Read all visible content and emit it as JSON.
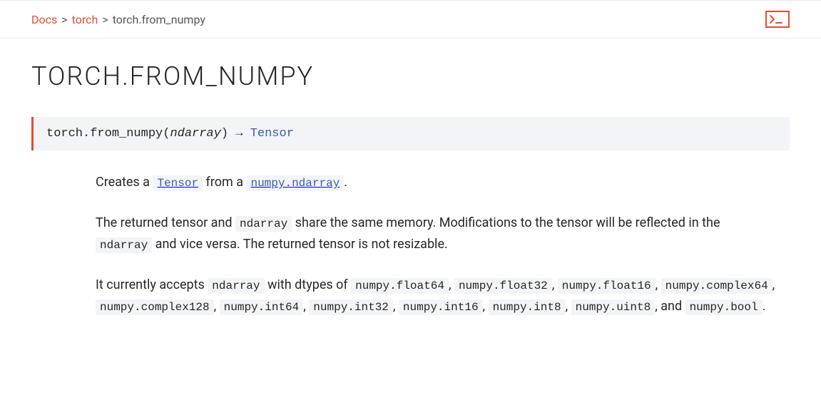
{
  "breadcrumb": {
    "items": [
      "Docs",
      "torch",
      "torch.from_numpy"
    ],
    "sep": ">"
  },
  "title": "TORCH.FROM_NUMPY",
  "signature": {
    "qualname_prefix": "torch.",
    "func_name": "from_numpy",
    "open_paren": "(",
    "param": "ndarray",
    "close_paren": ")",
    "arrow": " → ",
    "return_type": "Tensor"
  },
  "desc": {
    "p1": {
      "t1": "Creates a ",
      "c1": "Tensor",
      "t2": " from a ",
      "c2": "numpy.ndarray",
      "t3": "."
    },
    "p2": {
      "t1": "The returned tensor and ",
      "c1": "ndarray",
      "t2": " share the same memory. Modifications to the tensor will be reflected in the ",
      "c2": "ndarray",
      "t3": " and vice versa. The returned tensor is not resizable."
    },
    "p3": {
      "t1": "It currently accepts ",
      "c1": "ndarray",
      "t2": " with dtypes of ",
      "c2": "numpy.float64",
      "s1": ", ",
      "c3": "numpy.float32",
      "s2": ", ",
      "c4": "numpy.float16",
      "s3": ", ",
      "c5": "numpy.complex64",
      "s4": ", ",
      "c6": "numpy.complex128",
      "s5": ", ",
      "c7": "numpy.int64",
      "s6": ", ",
      "c8": "numpy.int32",
      "s7": ", ",
      "c9": "numpy.int16",
      "s8": ", ",
      "c10": "numpy.int8",
      "s9": ", ",
      "c11": "numpy.uint8",
      "s10": ", and ",
      "c12": "numpy.bool",
      "s11": "."
    }
  }
}
